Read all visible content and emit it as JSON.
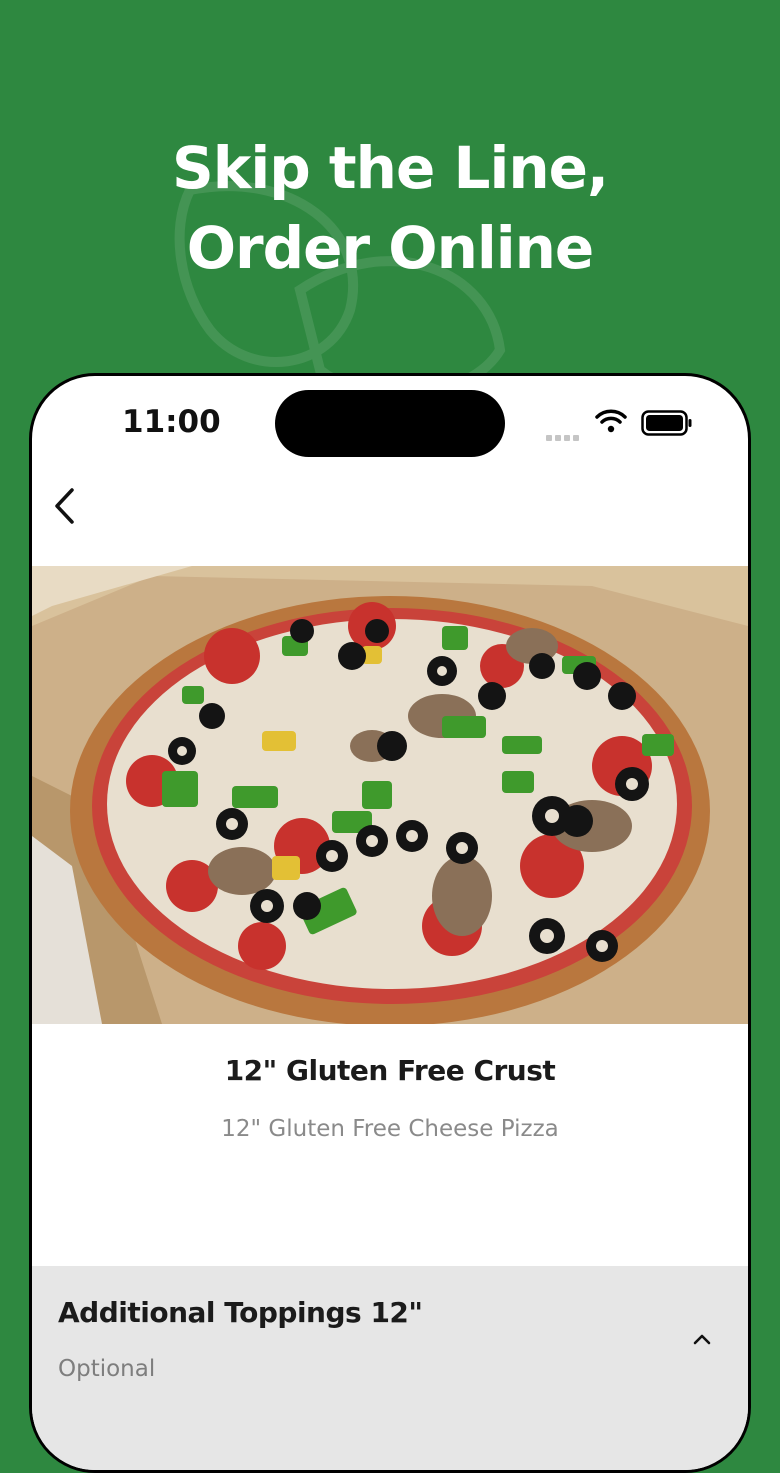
{
  "promo": {
    "headline_line1": "Skip the Line,",
    "headline_line2": "Order Online",
    "background_color": "#2e8840"
  },
  "status_bar": {
    "time": "11:00",
    "icons": [
      "cellular-signal-icon",
      "wifi-icon",
      "battery-icon"
    ]
  },
  "nav": {
    "back_icon": "chevron-left-icon"
  },
  "product": {
    "image": "pizza-photo",
    "name": "12\" Gluten Free Crust",
    "description": "12\" Gluten Free Cheese Pizza"
  },
  "modifier_section": {
    "title": "Additional Toppings 12\"",
    "subtitle": "Optional",
    "toggle_icon": "chevron-up-icon"
  }
}
